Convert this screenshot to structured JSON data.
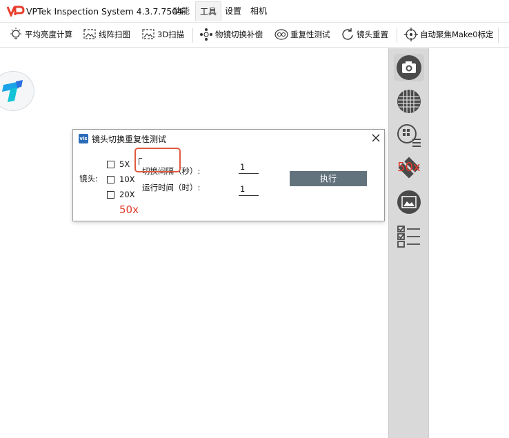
{
  "app": {
    "title": "VPTek Inspection System 4.3.7.7504",
    "logo_text": "VP",
    "menus": [
      "功能",
      "工具",
      "设置",
      "相机"
    ],
    "active_menu": "工具"
  },
  "toolbar": {
    "items": [
      {
        "label": "平均亮度计算",
        "icon": "lightbulb-icon"
      },
      {
        "label": "线阵扫图",
        "icon": "line-scan-icon"
      },
      {
        "label": "3D扫描",
        "icon": "3d-scan-icon"
      },
      {
        "label": "物镜切换补偿",
        "icon": "objective-switch-icon"
      },
      {
        "label": "重复性测试",
        "icon": "repeat-icon"
      },
      {
        "label": "镜头重置",
        "icon": "reset-icon"
      },
      {
        "label": "自动聚焦Make0标定",
        "icon": "crosshair-icon"
      }
    ]
  },
  "sidebar": {
    "red_label": "50x",
    "buttons": [
      "camera-icon",
      "grid-icon",
      "pattern-list-icon",
      "disable-icon",
      "image-frame-icon",
      "checklist-icon"
    ]
  },
  "dialog": {
    "title": "镜头切换重复性测试",
    "icon_text": "vis",
    "lens_label": "镜头:",
    "lenses": [
      "5X",
      "10X",
      "20X"
    ],
    "red_label": "50x",
    "interval_label": "切换间隔（秒）:",
    "interval_value": "1",
    "runtime_label": "运行时间（时）:",
    "runtime_value": "1",
    "execute_label": "执行"
  },
  "colors": {
    "accent_red": "#e03a2a",
    "button_bg": "#63737e",
    "sidebar_bg": "#d9d9d9"
  }
}
